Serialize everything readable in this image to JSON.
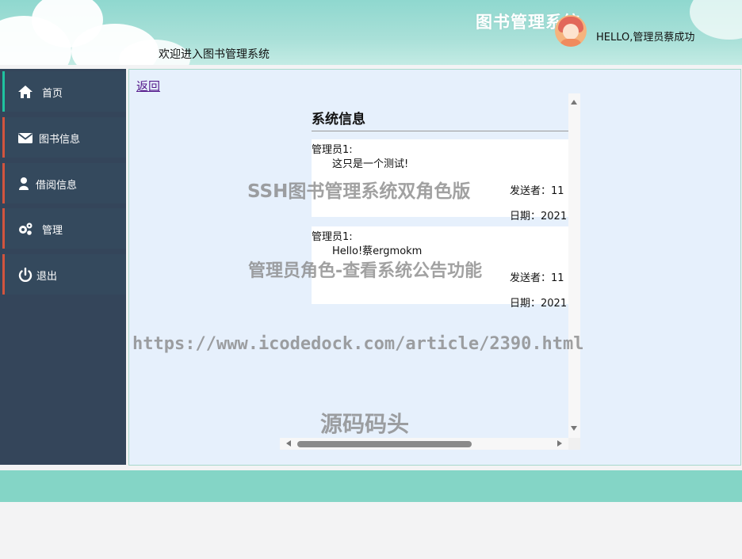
{
  "header": {
    "title": "图书管理系统",
    "welcome": "欢迎进入图书管理系统",
    "greeting": "HELLO,管理员蔡成功"
  },
  "sidebar": {
    "items": [
      {
        "label": "首页",
        "icon": "home-icon",
        "active": true
      },
      {
        "label": "图书信息",
        "icon": "envelope-icon",
        "active": false
      },
      {
        "label": "借阅信息",
        "icon": "user-icon",
        "active": false
      },
      {
        "label": "管理",
        "icon": "gears-icon",
        "active": false
      },
      {
        "label": "退出",
        "icon": "power-icon",
        "active": false
      }
    ]
  },
  "content": {
    "back_label": "返回",
    "panel_title": "系统信息",
    "notices": [
      {
        "author": "管理员1:",
        "body": "这只是一个测试!",
        "sender": "发送者：11",
        "date": "日期：2021"
      },
      {
        "author": "管理员1:",
        "body": "Hello!蔡ergmokm",
        "sender": "发送者：11",
        "date": "日期：2021"
      }
    ]
  },
  "watermarks": {
    "line1": "SSH图书管理系统双角色版",
    "line2": "管理员角色-查看系统公告功能",
    "line3": "https://www.icodedock.com/article/2390.html",
    "line4": "源码码头"
  },
  "colors": {
    "sidebar_bg": "#34455a",
    "active_accent": "#1fc2a0",
    "item_accent": "#d2543e",
    "footer": "#84d5c6",
    "content_bg": "#e6f0fc"
  }
}
